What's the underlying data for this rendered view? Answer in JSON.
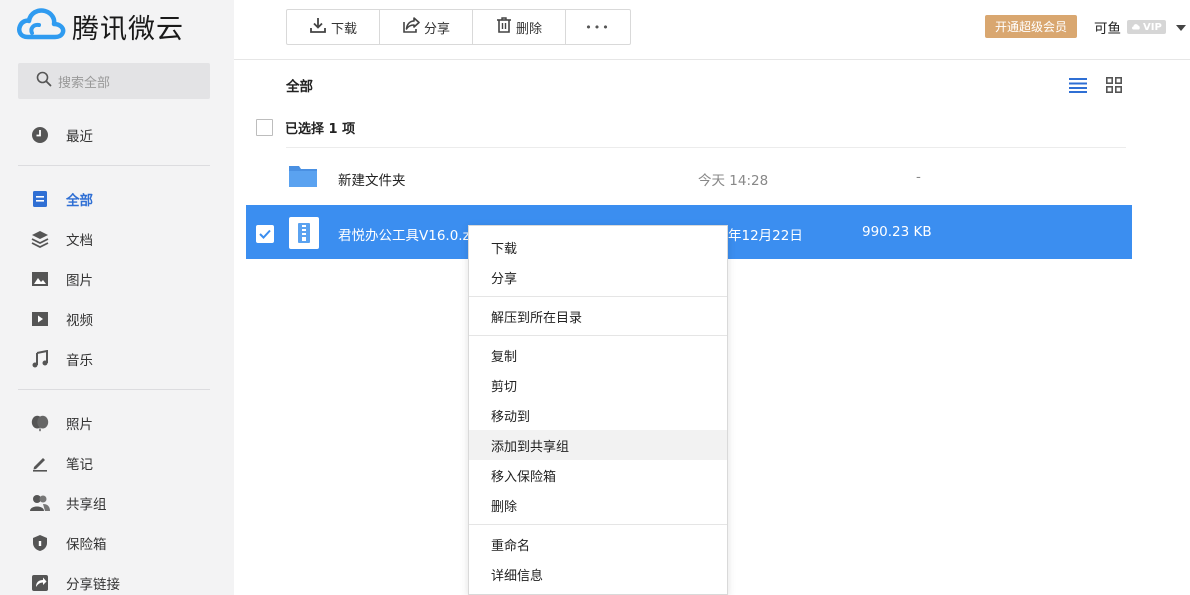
{
  "brand": {
    "name": "腾讯微云",
    "color": "#2f9bf0"
  },
  "search": {
    "placeholder": "搜索全部"
  },
  "sidebar": {
    "items": [
      {
        "label": "最近",
        "icon": "clock-icon"
      },
      {
        "label": "全部",
        "icon": "all-files-icon",
        "active": true
      },
      {
        "label": "文档",
        "icon": "layers-icon"
      },
      {
        "label": "图片",
        "icon": "image-icon"
      },
      {
        "label": "视频",
        "icon": "video-icon"
      },
      {
        "label": "音乐",
        "icon": "music-icon"
      },
      {
        "label": "照片",
        "icon": "balloon-icon"
      },
      {
        "label": "笔记",
        "icon": "pen-icon"
      },
      {
        "label": "共享组",
        "icon": "users-icon"
      },
      {
        "label": "保险箱",
        "icon": "shield-icon"
      },
      {
        "label": "分享链接",
        "icon": "share-link-icon"
      }
    ]
  },
  "toolbar": {
    "download_label": "下载",
    "share_label": "分享",
    "delete_label": "删除",
    "more_label": "•••"
  },
  "header": {
    "vip_button": "开通超级会员",
    "username": "可鱼",
    "vip_badge": "VIP"
  },
  "main": {
    "breadcrumb": "全部",
    "selection_text": "已选择 1 项",
    "files": [
      {
        "name": "新建文件夹",
        "date": "今天 14:28",
        "size": "-",
        "type": "folder",
        "selected": false
      },
      {
        "name": "君悦办公工具V16.0.z",
        "date": "年12月22日",
        "size": "990.23 KB",
        "type": "zip",
        "selected": true
      }
    ]
  },
  "context_menu": {
    "groups": [
      [
        "下载",
        "分享"
      ],
      [
        "解压到所在目录"
      ],
      [
        "复制",
        "剪切",
        "移动到",
        "添加到共享组",
        "移入保险箱",
        "删除"
      ],
      [
        "重命名",
        "详细信息"
      ]
    ],
    "hovered": "添加到共享组"
  },
  "colors": {
    "accent": "#3b8ef0",
    "active_nav": "#2f6fd4",
    "vip": "#d9a770"
  }
}
